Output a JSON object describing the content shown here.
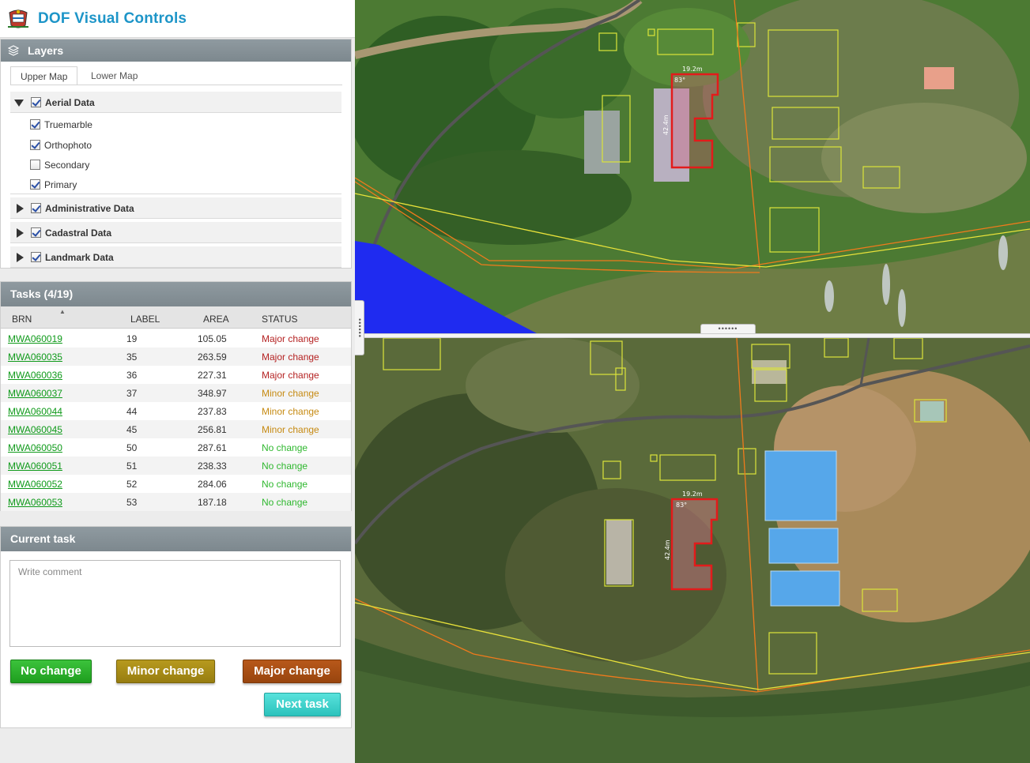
{
  "app": {
    "title": "DOF Visual Controls"
  },
  "layers": {
    "title": "Layers",
    "tabs": [
      {
        "label": "Upper Map",
        "active": true
      },
      {
        "label": "Lower Map",
        "active": false
      }
    ],
    "groups": [
      {
        "label": "Aerial Data",
        "checked": true,
        "expanded": true,
        "children": [
          {
            "label": "Truemarble",
            "checked": true
          },
          {
            "label": "Orthophoto",
            "checked": true
          },
          {
            "label": "Secondary",
            "checked": false
          },
          {
            "label": "Primary",
            "checked": true
          }
        ]
      },
      {
        "label": "Administrative Data",
        "checked": true,
        "expanded": false
      },
      {
        "label": "Cadastral Data",
        "checked": true,
        "expanded": false
      },
      {
        "label": "Landmark Data",
        "checked": true,
        "expanded": false
      }
    ]
  },
  "tasks": {
    "title": "Tasks (4/19)",
    "columns": [
      "BRN",
      "LABEL",
      "AREA",
      "STATUS"
    ],
    "rows": [
      {
        "brn": "MWA060019",
        "label": "19",
        "area": "105.05",
        "status": "Major change"
      },
      {
        "brn": "MWA060035",
        "label": "35",
        "area": "263.59",
        "status": "Major change"
      },
      {
        "brn": "MWA060036",
        "label": "36",
        "area": "227.31",
        "status": "Major change"
      },
      {
        "brn": "MWA060037",
        "label": "37",
        "area": "348.97",
        "status": "Minor change"
      },
      {
        "brn": "MWA060044",
        "label": "44",
        "area": "237.83",
        "status": "Minor change"
      },
      {
        "brn": "MWA060045",
        "label": "45",
        "area": "256.81",
        "status": "Minor change"
      },
      {
        "brn": "MWA060050",
        "label": "50",
        "area": "287.61",
        "status": "No change"
      },
      {
        "brn": "MWA060051",
        "label": "51",
        "area": "238.33",
        "status": "No change"
      },
      {
        "brn": "MWA060052",
        "label": "52",
        "area": "284.06",
        "status": "No change"
      },
      {
        "brn": "MWA060053",
        "label": "53",
        "area": "187.18",
        "status": "No change"
      }
    ]
  },
  "current_task": {
    "title": "Current task",
    "comment_placeholder": "Write comment",
    "comment_value": "",
    "buttons": {
      "no_change": "No change",
      "minor_change": "Minor change",
      "major_change": "Major change",
      "next_task": "Next task"
    }
  },
  "maps": {
    "building_dimensions": {
      "width_top": "19.2m",
      "height_left": "42.4m",
      "corner_angle": "83°"
    },
    "splitter_handle": "••••••"
  },
  "colors": {
    "title": "#1d95c8",
    "panel_header": "#8a959b",
    "link": "#0f9a1a",
    "major": "#b52323",
    "minor": "#c68a12",
    "no_change": "#2fb82f",
    "next_task": "#3ad2cc"
  }
}
